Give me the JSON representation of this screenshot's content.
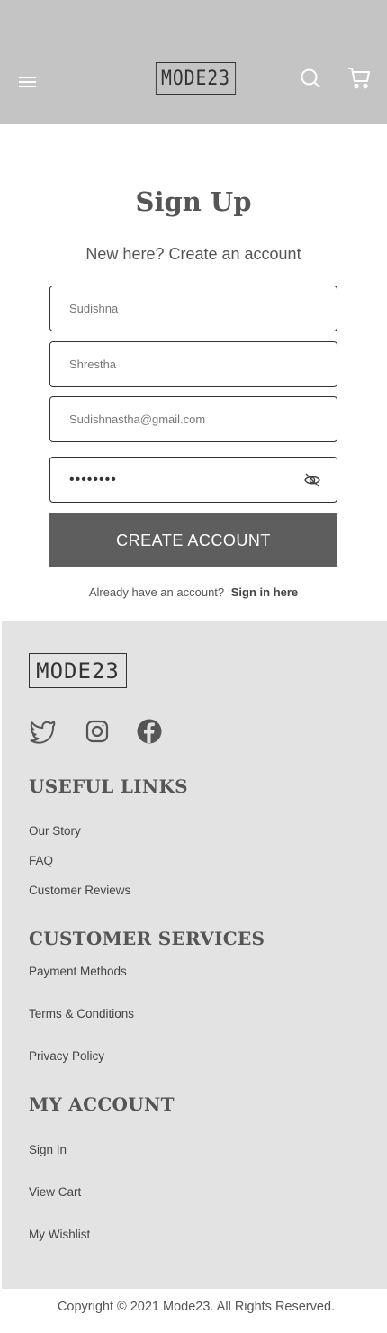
{
  "header": {
    "logo_text": "MODE23",
    "icons": {
      "menu": "hamburger-menu-icon",
      "search": "search-icon",
      "cart": "cart-icon"
    }
  },
  "signup": {
    "title": "Sign Up",
    "subtitle": "New here? Create an account",
    "first_name": "Sudishna",
    "last_name": "Shrestha",
    "email": "Sudishnastha@gmail.com",
    "password": "••••••••",
    "create_button": "CREATE ACCOUNT",
    "already_text": "Already have an account?",
    "sign_in_link": "Sign in here"
  },
  "footer": {
    "logo_text": "MODE23",
    "social": [
      "twitter-icon",
      "instagram-icon",
      "facebook-icon"
    ],
    "useful_links": {
      "heading": "USEFUL LINKS",
      "items": [
        "Our Story",
        "FAQ",
        "Customer Reviews"
      ]
    },
    "customer_services": {
      "heading": "CUSTOMER SERVICES",
      "items": [
        "Payment Methods",
        "Terms & Conditions",
        "Privacy Policy"
      ]
    },
    "my_account": {
      "heading": "MY ACCOUNT",
      "items": [
        "Sign In",
        "View Cart",
        "My Wishlist"
      ]
    }
  },
  "copyright": "Copyright © 2021 Mode23. All Rights Reserved.",
  "colors": {
    "header_bg": "#c4c4c4",
    "footer_bg": "#e3e3e3",
    "button_bg": "#5e5e5e",
    "text": "#555555"
  }
}
